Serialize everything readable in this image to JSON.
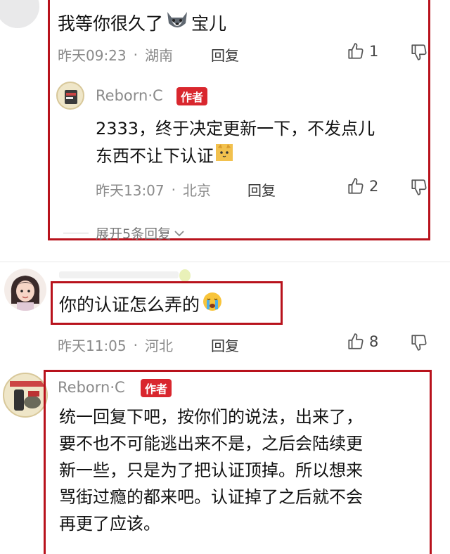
{
  "comment1": {
    "text": "我等你很久了",
    "text_suffix": "宝儿",
    "date": "昨天09:23",
    "location": "湖南",
    "reply_label": "回复",
    "likes": "1"
  },
  "reply1": {
    "author": "Reborn·C",
    "author_tag": "作者",
    "line1": "2333，终于决定更新一下，不发点儿",
    "line2": "东西不让下认证",
    "date": "昨天13:07",
    "location": "北京",
    "reply_label": "回复",
    "likes": "2",
    "expand_label": "展开5条回复"
  },
  "comment2": {
    "text": "你的认证怎么弄的",
    "date": "昨天11:05",
    "location": "河北",
    "reply_label": "回复",
    "likes": "8"
  },
  "comment3": {
    "author": "Reborn·C",
    "author_tag": "作者",
    "line1": "统一回复下吧，按你们的说法，出来了，",
    "line2": "要不也不可能逃出来不是，之后会陆续更",
    "line3": "新一些，只是为了把认证顶掉。所以想来",
    "line4": "骂街过瘾的都来吧。认证掉了之后就不会",
    "line5": "再更了应该。"
  },
  "colors": {
    "highlight_box": "#b8121c",
    "author_tag": "#d9272e",
    "meta": "#8a8a8a"
  }
}
